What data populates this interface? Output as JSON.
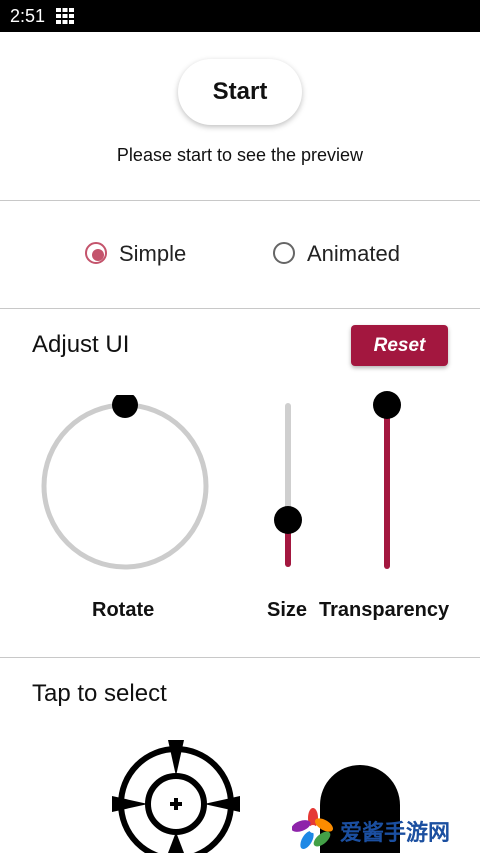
{
  "status_bar": {
    "time": "2:51",
    "apps_icon": "grid-icon"
  },
  "preview": {
    "start_label": "Start",
    "message": "Please start to see the preview"
  },
  "mode": {
    "options": [
      {
        "label": "Simple",
        "selected": true
      },
      {
        "label": "Animated",
        "selected": false
      }
    ],
    "accent_color": "#c4546c"
  },
  "adjust": {
    "title": "Adjust UI",
    "reset_label": "Reset",
    "rotate_label": "Rotate",
    "size_label": "Size",
    "transparency_label": "Transparency",
    "size_level": 0.25,
    "transparency_level": 1.0,
    "slider_color": "#a3173f"
  },
  "select": {
    "title": "Tap to select",
    "options": [
      "crosshair-target-icon",
      "dome-icon"
    ]
  },
  "watermark": {
    "text": "爱酱手游网"
  }
}
